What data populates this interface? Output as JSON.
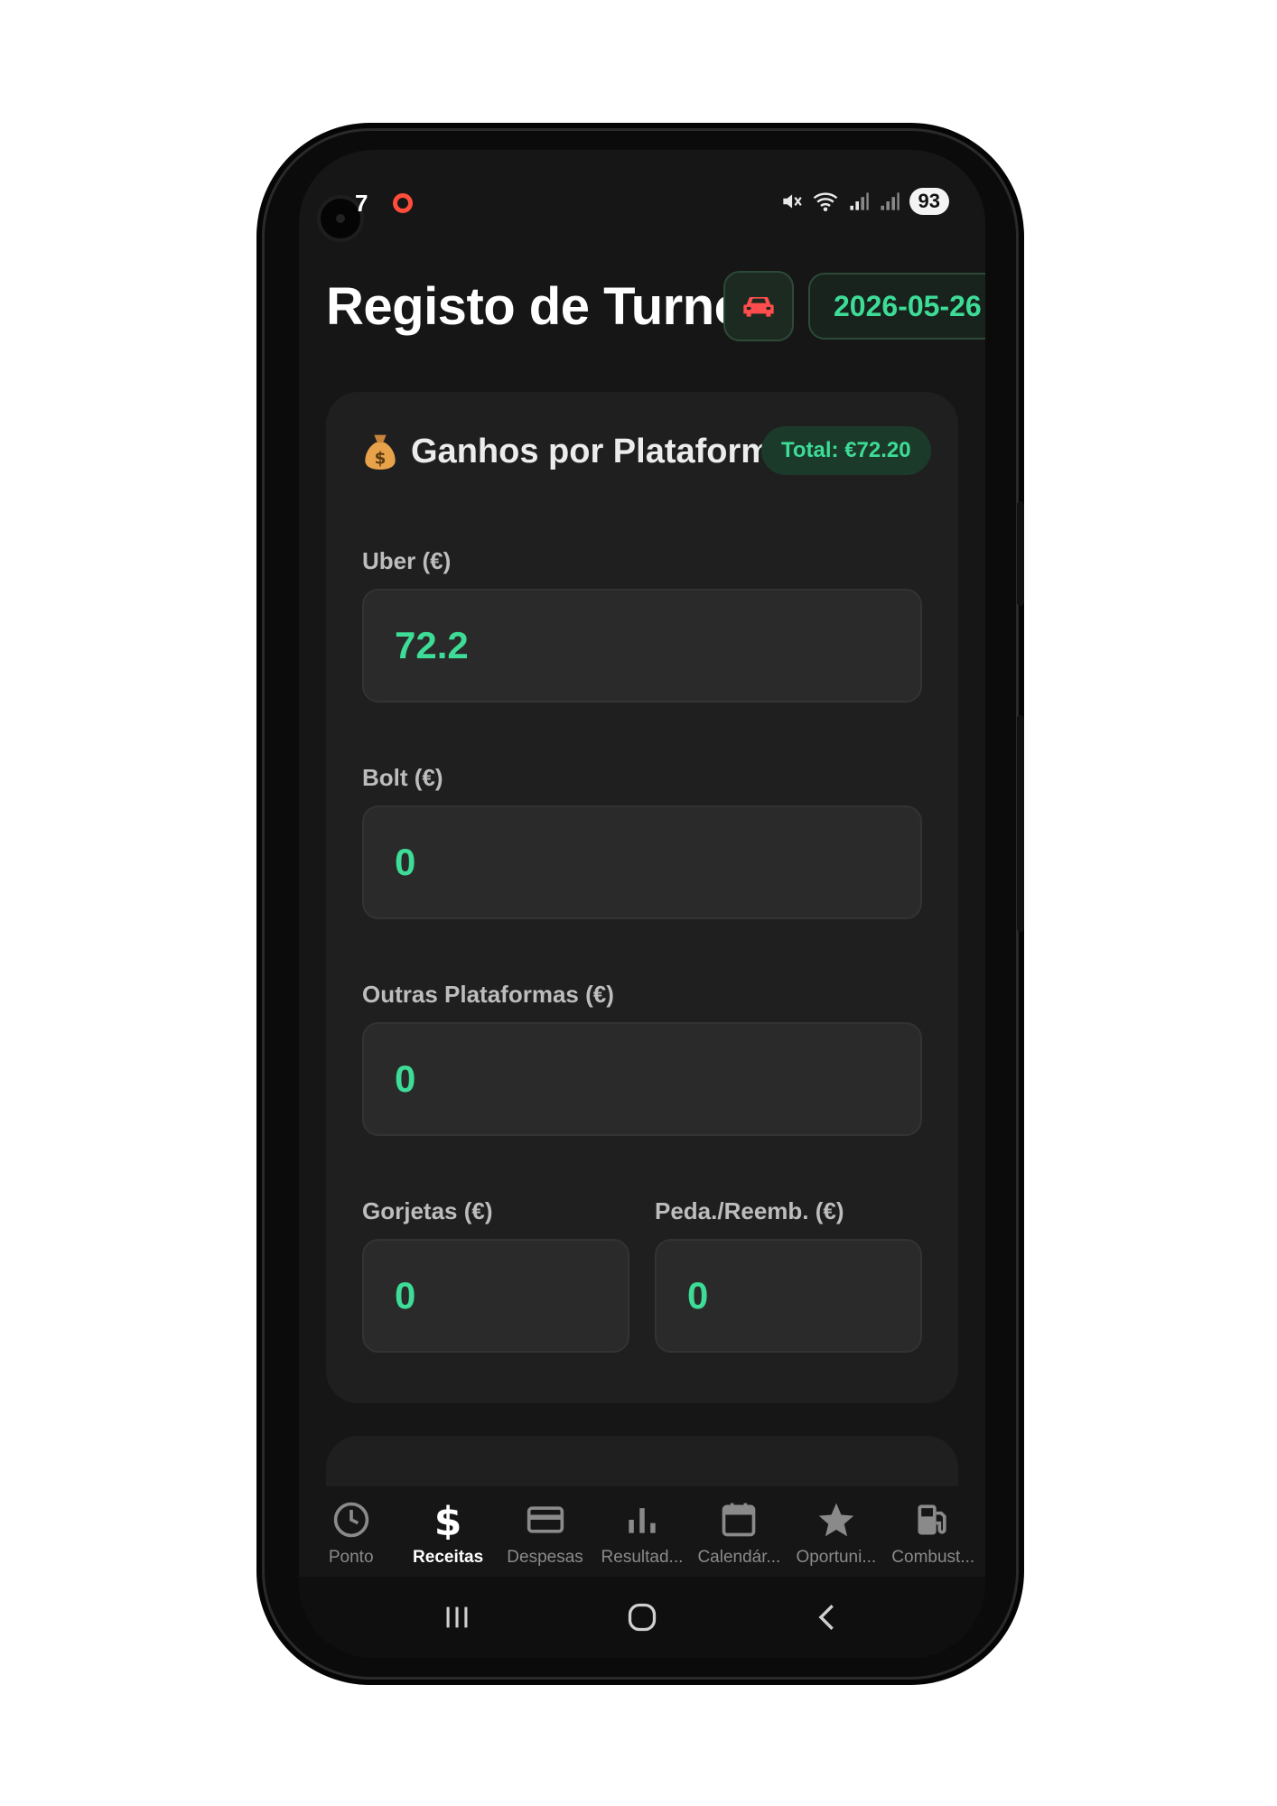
{
  "status_bar": {
    "time": "7",
    "battery": "93",
    "icons": [
      "rec-dot-icon",
      "mute-icon",
      "wifi-icon",
      "signal-icon",
      "signal-icon"
    ]
  },
  "header": {
    "title": "Registo de Turno",
    "date": "2026-05-26",
    "car_icon": "car-icon"
  },
  "earnings_card": {
    "title": "Ganhos por Plataforma",
    "icon": "money-bag-icon",
    "total": "Total: €72.20",
    "fields": {
      "uber": {
        "label": "Uber (€)",
        "value": "72.2"
      },
      "bolt": {
        "label": "Bolt (€)",
        "value": "0"
      },
      "outras": {
        "label": "Outras Plataformas (€)",
        "value": "0"
      },
      "gorjetas": {
        "label": "Gorjetas (€)",
        "value": "0"
      },
      "peda": {
        "label": "Peda./Reemb. (€)",
        "value": "0"
      }
    }
  },
  "bottom_nav": {
    "items": [
      {
        "label": "Ponto",
        "icon": "clock-icon"
      },
      {
        "label": "Receitas",
        "icon": "dollar-icon",
        "active": true
      },
      {
        "label": "Despesas",
        "icon": "card-icon"
      },
      {
        "label": "Resultad...",
        "icon": "bar-chart-icon"
      },
      {
        "label": "Calendár...",
        "icon": "calendar-icon"
      },
      {
        "label": "Oportuni...",
        "icon": "star-icon"
      },
      {
        "label": "Combust...",
        "icon": "fuel-icon"
      }
    ]
  },
  "system_nav": [
    "recents-icon",
    "home-icon",
    "back-icon"
  ],
  "colors": {
    "accent": "#3ddc97",
    "background": "#161616",
    "card": "#1f1f1f",
    "input": "#2a2a2a",
    "car_icon": "#ff4d4d"
  }
}
